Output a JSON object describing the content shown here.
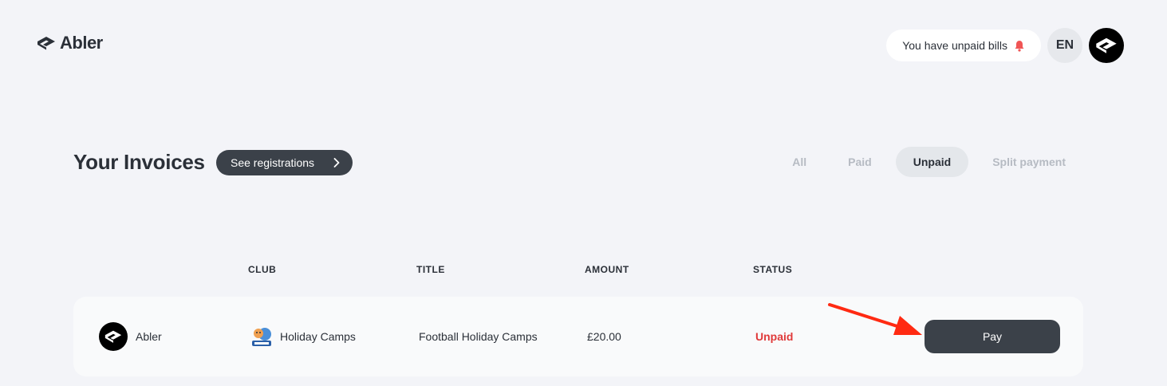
{
  "header": {
    "logo_text": "Abler",
    "bills_label": "You have unpaid bills",
    "language": "EN"
  },
  "main": {
    "title": "Your Invoices",
    "see_registrations_label": "See registrations",
    "filters": [
      {
        "label": "All",
        "active": false
      },
      {
        "label": "Paid",
        "active": false
      },
      {
        "label": "Unpaid",
        "active": true
      },
      {
        "label": "Split payment",
        "active": false
      }
    ]
  },
  "table": {
    "columns": [
      "CLUB",
      "TITLE",
      "AMOUNT",
      "STATUS"
    ],
    "rows": [
      {
        "org": "Abler",
        "club": "Holiday Camps",
        "title": "Football Holiday Camps",
        "amount": "£20.00",
        "status": "Unpaid",
        "action": "Pay"
      }
    ]
  },
  "colors": {
    "background": "#f3f4f8",
    "dark_button": "#3b4149",
    "status_unpaid": "#e03a3a",
    "arrow": "#ff2a12"
  },
  "icons": {
    "logo": "abler-logo-icon",
    "bell": "bell-icon",
    "avatar": "abler-avatar-icon",
    "chevron": "chevron-right-icon",
    "club_badge": "tigers-badge-icon"
  }
}
